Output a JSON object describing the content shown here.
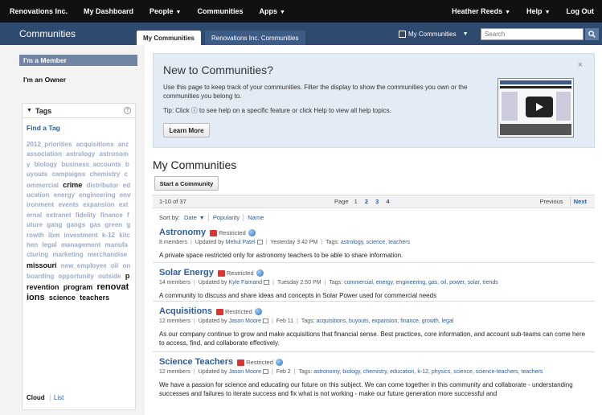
{
  "topnav": {
    "items": [
      "Renovations Inc.",
      "My Dashboard",
      "People",
      "Communities",
      "Apps"
    ],
    "user": "Heather Reeds",
    "help": "Help",
    "logout": "Log Out"
  },
  "subbar": {
    "title": "Communities",
    "tabs": [
      "My Communities",
      "Renovations Inc. Communities"
    ],
    "scope_label": "My Communities",
    "search_placeholder": "Search"
  },
  "sidebar": {
    "member": "I'm a Member",
    "owner": "I'm an Owner",
    "tags_title": "Tags",
    "find_tag": "Find a Tag",
    "tags": [
      {
        "t": "2012_priorities",
        "w": "l"
      },
      {
        "t": "acquisitions",
        "w": "l"
      },
      {
        "t": "anz",
        "w": "l"
      },
      {
        "t": "association",
        "w": "l"
      },
      {
        "t": "astrology",
        "w": "l"
      },
      {
        "t": "astronomy",
        "w": "l"
      },
      {
        "t": "biology",
        "w": "l"
      },
      {
        "t": "business_accounts",
        "w": "l"
      },
      {
        "t": "buyouts",
        "w": "l"
      },
      {
        "t": "campaigns",
        "w": "l"
      },
      {
        "t": "chemistry",
        "w": "l"
      },
      {
        "t": "commercial",
        "w": "l"
      },
      {
        "t": "crime",
        "w": "d"
      },
      {
        "t": "distributor",
        "w": "l"
      },
      {
        "t": "education",
        "w": "l"
      },
      {
        "t": "energy",
        "w": "l"
      },
      {
        "t": "engineering",
        "w": "l"
      },
      {
        "t": "environment",
        "w": "l"
      },
      {
        "t": "events",
        "w": "l"
      },
      {
        "t": "expansion",
        "w": "l"
      },
      {
        "t": "external",
        "w": "l"
      },
      {
        "t": "extranet",
        "w": "l"
      },
      {
        "t": "fidelity",
        "w": "l"
      },
      {
        "t": "finance",
        "w": "l"
      },
      {
        "t": "future",
        "w": "l"
      },
      {
        "t": "gang",
        "w": "l"
      },
      {
        "t": "gangs",
        "w": "l"
      },
      {
        "t": "gas",
        "w": "l"
      },
      {
        "t": "green",
        "w": "l"
      },
      {
        "t": "growth",
        "w": "l"
      },
      {
        "t": "ibm",
        "w": "l"
      },
      {
        "t": "investment",
        "w": "l"
      },
      {
        "t": "k-12",
        "w": "l"
      },
      {
        "t": "kitchen",
        "w": "l"
      },
      {
        "t": "legal",
        "w": "l"
      },
      {
        "t": "management",
        "w": "l"
      },
      {
        "t": "manufacturing",
        "w": "l"
      },
      {
        "t": "marketing",
        "w": "l"
      },
      {
        "t": "merchandise",
        "w": "l"
      },
      {
        "t": "missouri",
        "w": "d"
      },
      {
        "t": "new_employee",
        "w": "l"
      },
      {
        "t": "oil",
        "w": "l"
      },
      {
        "t": "onboarding",
        "w": "l"
      },
      {
        "t": "opportunity",
        "w": "l"
      },
      {
        "t": "outside",
        "w": "l"
      },
      {
        "t": "prevention",
        "w": "m"
      },
      {
        "t": "program",
        "w": "m"
      },
      {
        "t": "renovations",
        "w": "big"
      },
      {
        "t": "science",
        "w": "m"
      },
      {
        "t": "teachers",
        "w": "m"
      }
    ],
    "cloud": "Cloud",
    "list": "List"
  },
  "banner": {
    "title": "New to Communities?",
    "text1": "Use this page to keep track of your communities. Filter the display to show the communities you own or the communities you belong to.",
    "text2": "Tip: Click ⓘ to see help on a specific feature or click Help to view all help topics.",
    "learn_more": "Learn More",
    "close": "×"
  },
  "main": {
    "title": "My Communities",
    "start_button": "Start a Community",
    "pager": {
      "count": "1-10 of 37",
      "page_label": "Page",
      "pages": [
        "1",
        "2",
        "3",
        "4"
      ],
      "previous": "Previous",
      "next": "Next"
    },
    "sort": {
      "label": "Sort by:",
      "options": [
        "Date",
        "Popularity",
        "Name"
      ]
    },
    "restricted_label": "Restricted",
    "communities": [
      {
        "name": "Astronomy",
        "members": "8 members",
        "updated_by_label": "Updated by",
        "updater": "Mehul Patel",
        "date": "Yesterday 3:42 PM",
        "tags_label": "Tags:",
        "tags": "astrology, science, teachers",
        "desc": "A private space restricted only for astronomy teachers to be able to share information."
      },
      {
        "name": "Solar Energy",
        "members": "14 members",
        "updated_by_label": "Updated by",
        "updater": "Kyle Farnand",
        "date": "Tuesday 2:50 PM",
        "tags_label": "Tags:",
        "tags": "commercial, energy, engineering, gas, oil, power, solar, trends",
        "desc": "A community to discuss and share ideas and concepts in Solar Power used for commercial needs"
      },
      {
        "name": "Acquisitions",
        "members": "12 members",
        "updated_by_label": "Updated by",
        "updater": "Jason Moore",
        "date": "Feb 11",
        "tags_label": "Tags:",
        "tags": "acquisitions, buyouts, expansion, finance, growth, legal",
        "desc": "As our company continue to grow and make acquisitions that financial sense.  Best practices, core information, and account sub-teams can come here to access, find, and collaborate effectively."
      },
      {
        "name": "Science Teachers",
        "members": "12 members",
        "updated_by_label": "Updated by",
        "updater": "Jason Moore",
        "date": "Feb 2",
        "tags_label": "Tags:",
        "tags": "astronomy, biology, chemistry, education, k-12, physics, science, science-teachers, teachers",
        "desc": "We have a passion for science and educating our future on this subject.  We can come together in this community and collaborate - understanding successes and failures to iterate success and fix what is not working - make our future generation more successful and"
      }
    ]
  }
}
